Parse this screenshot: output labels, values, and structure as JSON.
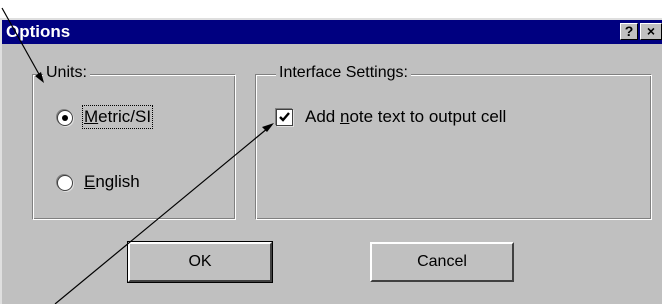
{
  "dialog": {
    "title": "Options",
    "help_glyph": "?",
    "close_glyph": "×"
  },
  "units_group": {
    "legend": "Units:",
    "options": [
      {
        "prefix": "",
        "accel": "M",
        "rest": "etric/SI",
        "selected": true
      },
      {
        "prefix": "",
        "accel": "E",
        "rest": "nglish",
        "selected": false
      }
    ]
  },
  "interface_group": {
    "legend": "Interface Settings:",
    "checkbox": {
      "prefix": "Add ",
      "accel": "n",
      "rest": "ote text to output cell",
      "checked": true
    }
  },
  "buttons": {
    "ok": "OK",
    "cancel": "Cancel"
  },
  "colors": {
    "titlebar": "#000080",
    "face": "#c0c0c0"
  }
}
